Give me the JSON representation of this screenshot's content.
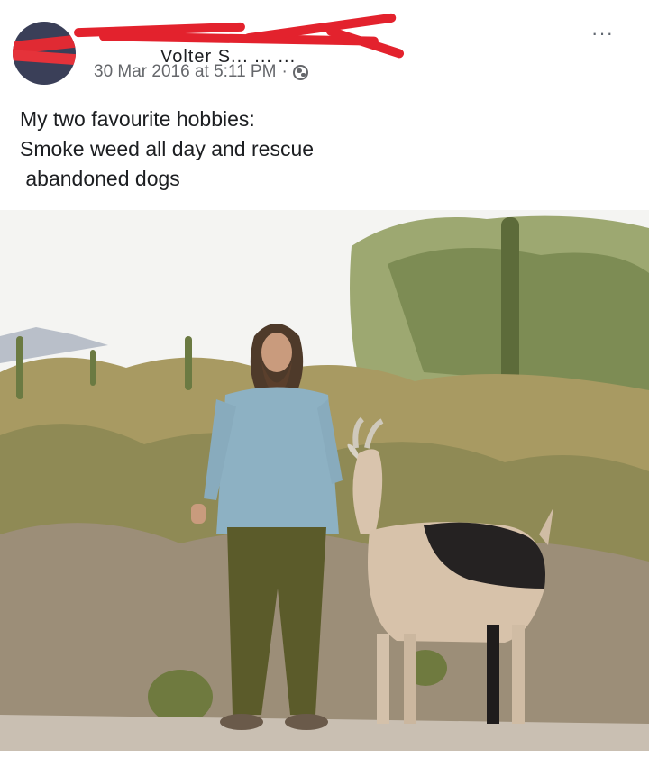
{
  "post": {
    "author_name": "Volter S... ... ...",
    "timestamp": "30 Mar 2016 at 5:11 PM",
    "separator": "·",
    "privacy_icon": "globe-icon",
    "more_icon": "···",
    "text_lines": [
      "My two favourite hobbies:",
      "Smoke weed all day and rescue",
      " abandoned dogs"
    ]
  },
  "colors": {
    "redaction": "#e3222d",
    "meta_text": "#65676b",
    "body_text": "#1c1e21"
  }
}
